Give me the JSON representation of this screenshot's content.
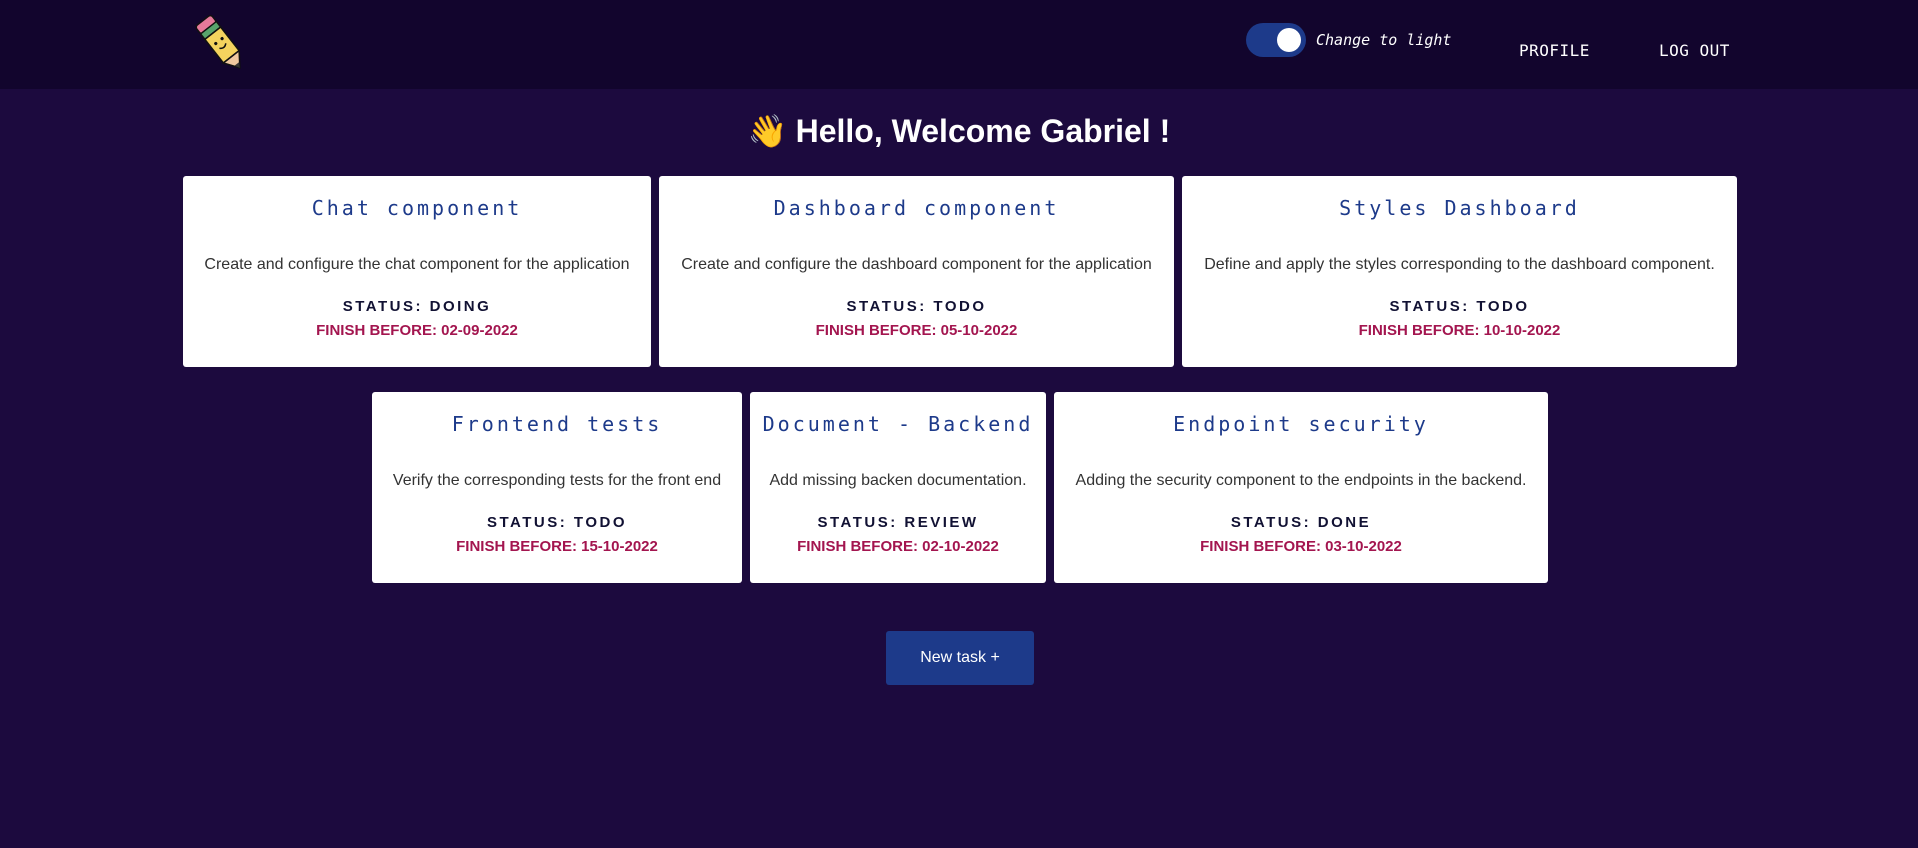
{
  "header": {
    "logo_icon": "pencil-icon",
    "theme_toggle_label": "Change to light",
    "theme_toggle_on": true,
    "nav": {
      "profile": "PROFILE",
      "logout": "LOG OUT"
    }
  },
  "welcome": {
    "wave": "👋",
    "text": "Hello, Welcome Gabriel !"
  },
  "tasks": [
    {
      "title": "Chat component",
      "description": "Create and configure the chat component for the application",
      "status": "STATUS: DOING",
      "finish": "FINISH BEFORE: 02-09-2022"
    },
    {
      "title": "Dashboard component",
      "description": "Create and configure the dashboard component for the application",
      "status": "STATUS: TODO",
      "finish": "FINISH BEFORE: 05-10-2022"
    },
    {
      "title": "Styles Dashboard",
      "description": "Define and apply the styles corresponding to the dashboard component.",
      "status": "STATUS: TODO",
      "finish": "FINISH BEFORE: 10-10-2022"
    },
    {
      "title": "Frontend tests",
      "description": "Verify the corresponding tests for the front end",
      "status": "STATUS: TODO",
      "finish": "FINISH BEFORE: 15-10-2022"
    },
    {
      "title": "Document - Backend",
      "description": "Add missing backen documentation.",
      "status": "STATUS: REVIEW",
      "finish": "FINISH BEFORE: 02-10-2022"
    },
    {
      "title": "Endpoint security",
      "description": "Adding the security component to the endpoints in the backend.",
      "status": "STATUS: DONE",
      "finish": "FINISH BEFORE: 03-10-2022"
    }
  ],
  "new_task_label": "New task +",
  "colors": {
    "background": "#1c0a3e",
    "navbar": "#12052d",
    "accent": "#1d3a8a",
    "finish_text": "#a3154f",
    "card": "#ffffff"
  }
}
